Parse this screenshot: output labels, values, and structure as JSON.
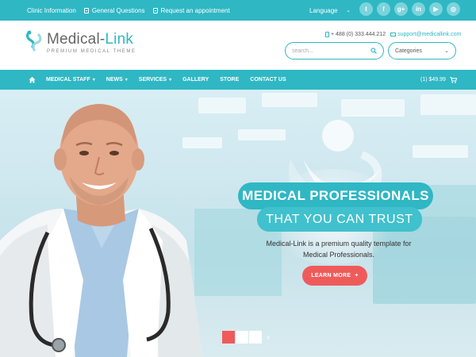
{
  "topbar": {
    "links": [
      {
        "label": "Clinic Information",
        "icon": "none"
      },
      {
        "label": "General Questions",
        "icon": "shield-icon"
      },
      {
        "label": "Request an appointment",
        "icon": "calendar-icon"
      }
    ],
    "language": "Language",
    "social": [
      {
        "name": "twitter-icon",
        "glyph": "t"
      },
      {
        "name": "facebook-icon",
        "glyph": "f"
      },
      {
        "name": "google-plus-icon",
        "glyph": "g+"
      },
      {
        "name": "linkedin-icon",
        "glyph": "in"
      },
      {
        "name": "youtube-icon",
        "glyph": "▶"
      },
      {
        "name": "rss-icon",
        "glyph": "◎"
      }
    ]
  },
  "header": {
    "logo_main": "Medical-",
    "logo_accent": "Link",
    "tagline": "PREMIUM MEDICAL THEME",
    "phone": "+ 488 (0) 333.444.212",
    "email": "support@medicallink.com",
    "search_placeholder": "search...",
    "categories_label": "Categories"
  },
  "nav": {
    "items": [
      {
        "label": "MEDICAL STAFF",
        "dropdown": true
      },
      {
        "label": "NEWS",
        "dropdown": true
      },
      {
        "label": "SERVICES",
        "dropdown": true
      },
      {
        "label": "GALLERY",
        "dropdown": false
      },
      {
        "label": "STORE",
        "dropdown": false
      },
      {
        "label": "CONTACT US",
        "dropdown": false
      }
    ],
    "cart_text": "(1) $49.99"
  },
  "hero": {
    "headline1": "MEDICAL PROFESSIONALS",
    "headline2": "THAT YOU CAN TRUST",
    "description": "Medical-Link is a premium quality template for Medical Professionals.",
    "button_label": "LEARN MORE",
    "button_icon": "+",
    "slides": 3,
    "active_slide": 1,
    "next_glyph": "›"
  },
  "colors": {
    "accent": "#2fb7c4",
    "button": "#ef5b5b"
  }
}
